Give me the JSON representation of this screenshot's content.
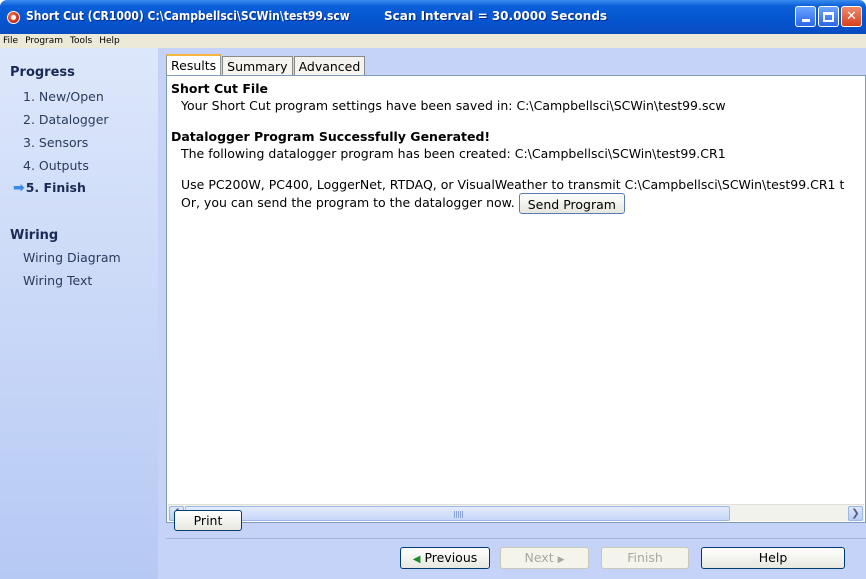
{
  "window": {
    "title": "Short Cut (CR1000) C:\\Campbellsci\\SCWin\\test99.scw",
    "scan_interval": "Scan Interval = 30.0000 Seconds"
  },
  "menu": [
    "File",
    "Program",
    "Tools",
    "Help"
  ],
  "sidebar": {
    "progress_heading": "Progress",
    "steps": [
      "1. New/Open",
      "2. Datalogger",
      "3. Sensors",
      "4. Outputs",
      "5. Finish"
    ],
    "active_step": "5. Finish",
    "wiring_heading": "Wiring",
    "wiring_items": [
      "Wiring Diagram",
      "Wiring Text"
    ]
  },
  "tabs": [
    "Results",
    "Summary",
    "Advanced"
  ],
  "active_tab": "Results",
  "results": {
    "section1_heading": "Short Cut File",
    "section1_text": "Your Short Cut program settings have been saved in: C:\\Campbellsci\\SCWin\\test99.scw",
    "section2_heading": "Datalogger Program Successfully Generated!",
    "section2_text": "The following datalogger program has been created: C:\\Campbellsci\\SCWin\\test99.CR1",
    "transmit_text": "Use PC200W, PC400, LoggerNet, RTDAQ, or VisualWeather to transmit C:\\Campbellsci\\SCWin\\test99.CR1 t",
    "send_text": "Or, you can send the program to the datalogger now.",
    "send_button": "Send Program"
  },
  "buttons": {
    "print": "Print",
    "previous": "Previous",
    "next": "Next",
    "finish": "Finish",
    "help": "Help"
  },
  "colors": {
    "titlebar": "#0555d0",
    "sidebar": "#c4d3f7",
    "tab_highlight": "#f6b53c"
  }
}
